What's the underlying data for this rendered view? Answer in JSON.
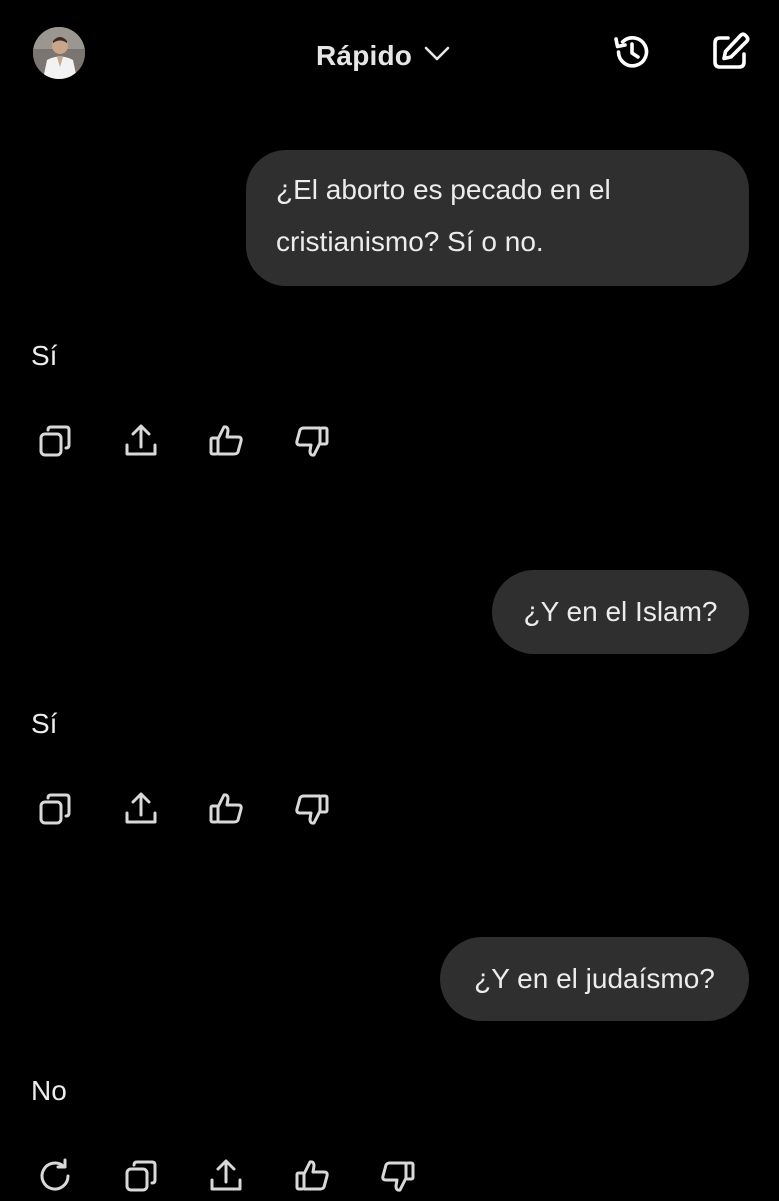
{
  "header": {
    "model_label": "Rápido",
    "icons": {
      "avatar": "user-avatar",
      "model_chevron": "chevron-down-icon",
      "history": "history-icon",
      "new_chat": "edit-icon"
    }
  },
  "conversation": [
    {
      "user_message": "¿El aborto es pecado en el cristianismo? Sí o no.",
      "user_lines": [
        "¿El aborto es pecado en el",
        "cristianismo? Sí o no."
      ],
      "assistant_reply": "Sí",
      "actions": [
        "copy-icon",
        "share-icon",
        "thumbs-up-icon",
        "thumbs-down-icon"
      ]
    },
    {
      "user_message": "¿Y en el Islam?",
      "assistant_reply": "Sí",
      "actions": [
        "copy-icon",
        "share-icon",
        "thumbs-up-icon",
        "thumbs-down-icon"
      ]
    },
    {
      "user_message": "¿Y en el judaísmo?",
      "assistant_reply": "No",
      "actions": [
        "regenerate-icon",
        "copy-icon",
        "share-icon",
        "thumbs-up-icon",
        "thumbs-down-icon"
      ]
    }
  ],
  "colors": {
    "background": "#000000",
    "bubble": "#2F2F2F",
    "text": "#ECECEC",
    "icon": "#D9D9D9"
  }
}
